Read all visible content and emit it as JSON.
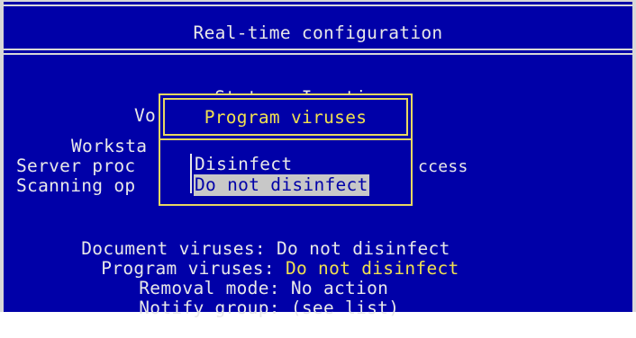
{
  "window": {
    "title": "Real-time configuration"
  },
  "status": {
    "label": "Status:",
    "value": "Inactive"
  },
  "background_rows": [
    {
      "id": "vo",
      "text": "Vo"
    },
    {
      "id": "worksta",
      "text": "Worksta"
    },
    {
      "id": "server",
      "text": "Server proc"
    },
    {
      "id": "scanning",
      "text": "Scanning op"
    }
  ],
  "background_tail": {
    "text": "ccess"
  },
  "popup": {
    "title": "Program viruses",
    "options": [
      {
        "label": "Disinfect",
        "selected": false
      },
      {
        "label": "Do not disinfect",
        "selected": true
      }
    ]
  },
  "settings": [
    {
      "label": "Document viruses:",
      "value": "Do not disinfect",
      "highlight": false
    },
    {
      "label": "Program viruses:",
      "value": "Do not disinfect",
      "highlight": true
    },
    {
      "label": "Removal mode:",
      "value": "No action",
      "highlight": false
    },
    {
      "label": "Notify group:",
      "value": "(see list)",
      "highlight": false
    }
  ],
  "colors": {
    "background": "#0000a8",
    "text": "#e8e8e8",
    "highlight": "#f0e050",
    "selection": "#c8c8c8"
  }
}
